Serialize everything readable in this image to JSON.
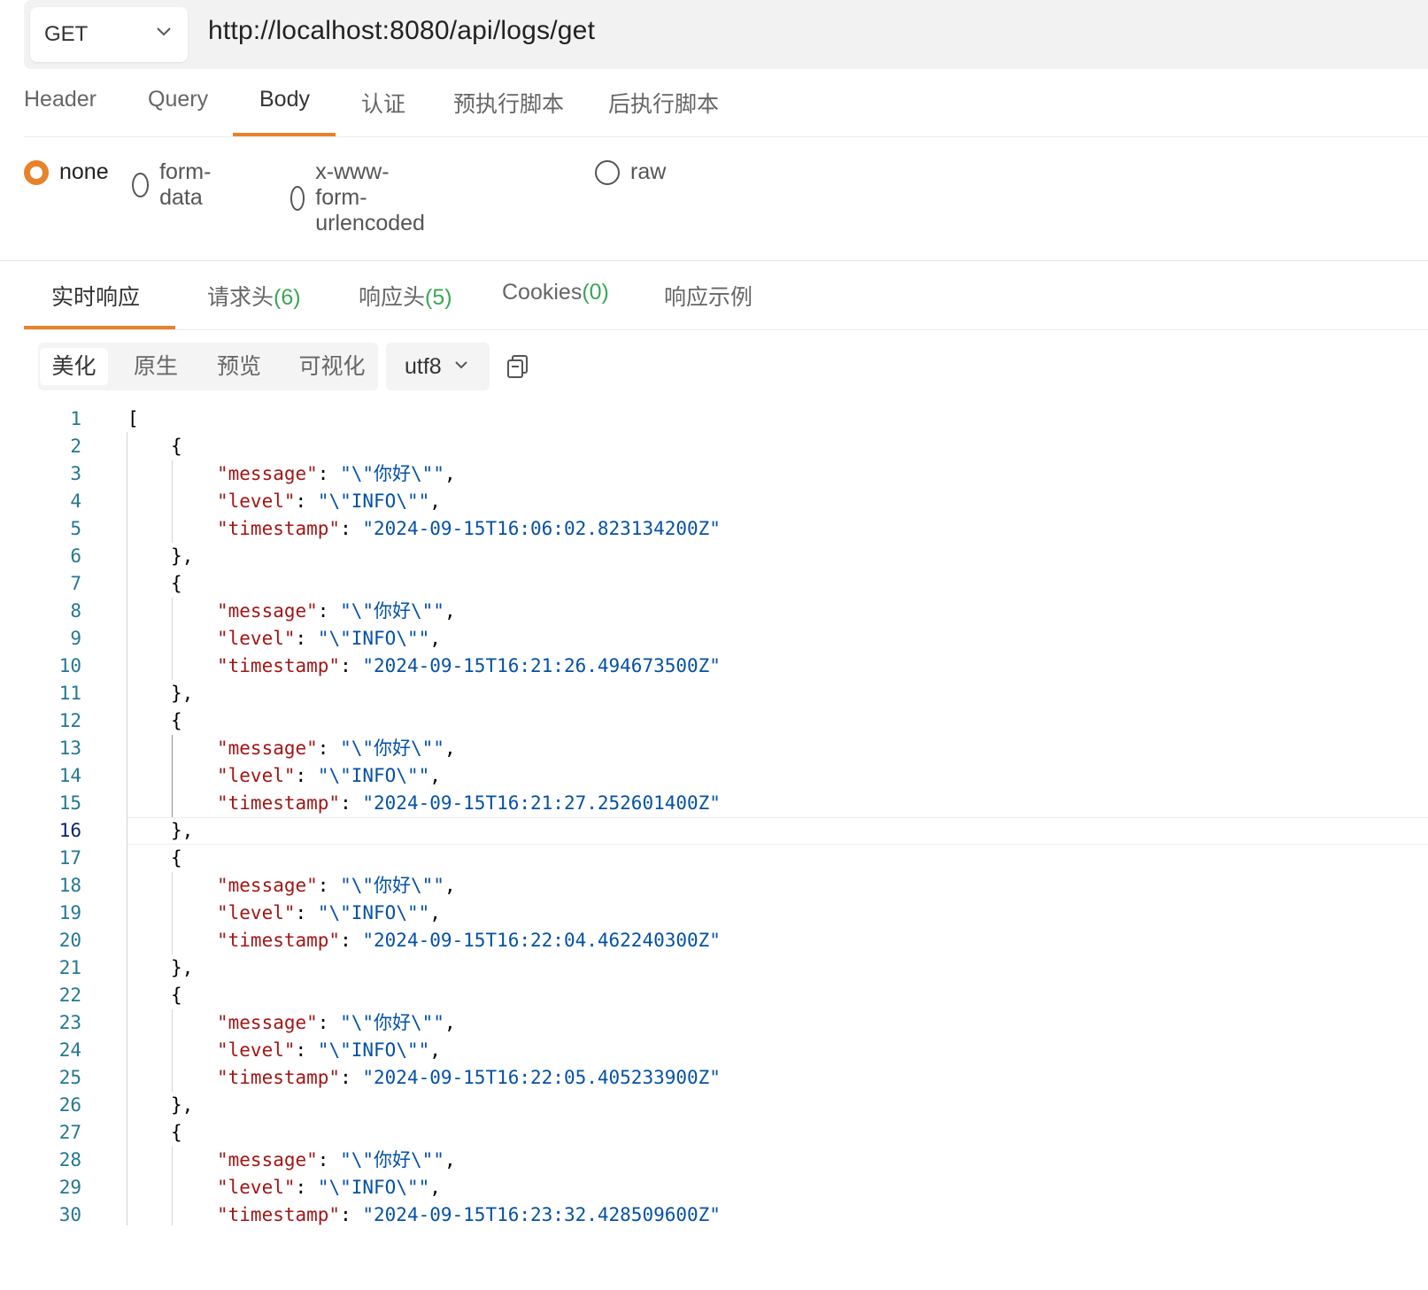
{
  "request": {
    "method": "GET",
    "url": "http://localhost:8080/api/logs/get"
  },
  "request_tabs": [
    {
      "label": "Header"
    },
    {
      "label": "Query"
    },
    {
      "label": "Body"
    },
    {
      "label": "认证"
    },
    {
      "label": "预执行脚本"
    },
    {
      "label": "后执行脚本"
    }
  ],
  "active_request_tab": "Body",
  "body_types": [
    {
      "label": "none"
    },
    {
      "label": "form-data"
    },
    {
      "label": "x-www-form-urlencoded"
    },
    {
      "label": "raw"
    }
  ],
  "selected_body_type": "none",
  "response_tabs": [
    {
      "label": "实时响应",
      "count": ""
    },
    {
      "label": "请求头",
      "count": "(6)"
    },
    {
      "label": "响应头",
      "count": "(5)"
    },
    {
      "label": "Cookies",
      "count": "(0)"
    },
    {
      "label": "响应示例",
      "count": ""
    }
  ],
  "view_modes": [
    {
      "label": "美化"
    },
    {
      "label": "原生"
    },
    {
      "label": "预览"
    },
    {
      "label": "可视化"
    }
  ],
  "active_view_mode": "美化",
  "encoding": "utf8",
  "current_line": 16,
  "colors": {
    "accent": "#e8822a",
    "count_green": "#3aa657",
    "json_key": "#a31515",
    "json_string": "#0451a5",
    "line_number": "#237893"
  },
  "icons": {
    "method_dropdown": "chevron-down-icon",
    "encoding_dropdown": "chevron-down-icon",
    "copy": "copy-icon"
  },
  "code_lines": [
    {
      "n": "1",
      "indent": 0,
      "parts": [
        {
          "t": "p",
          "v": "["
        }
      ]
    },
    {
      "n": "2",
      "indent": 1,
      "parts": [
        {
          "t": "p",
          "v": "{"
        }
      ]
    },
    {
      "n": "3",
      "indent": 2,
      "parts": [
        {
          "t": "k",
          "v": "\"message\""
        },
        {
          "t": "p",
          "v": ": "
        },
        {
          "t": "s",
          "v": "\"\\\"你好\\\"\""
        },
        {
          "t": "p",
          "v": ","
        }
      ]
    },
    {
      "n": "4",
      "indent": 2,
      "parts": [
        {
          "t": "k",
          "v": "\"level\""
        },
        {
          "t": "p",
          "v": ": "
        },
        {
          "t": "s",
          "v": "\"\\\"INFO\\\"\""
        },
        {
          "t": "p",
          "v": ","
        }
      ]
    },
    {
      "n": "5",
      "indent": 2,
      "parts": [
        {
          "t": "k",
          "v": "\"timestamp\""
        },
        {
          "t": "p",
          "v": ": "
        },
        {
          "t": "s",
          "v": "\"2024-09-15T16:06:02.823134200Z\""
        }
      ]
    },
    {
      "n": "6",
      "indent": 1,
      "parts": [
        {
          "t": "p",
          "v": "},"
        }
      ]
    },
    {
      "n": "7",
      "indent": 1,
      "parts": [
        {
          "t": "p",
          "v": "{"
        }
      ]
    },
    {
      "n": "8",
      "indent": 2,
      "parts": [
        {
          "t": "k",
          "v": "\"message\""
        },
        {
          "t": "p",
          "v": ": "
        },
        {
          "t": "s",
          "v": "\"\\\"你好\\\"\""
        },
        {
          "t": "p",
          "v": ","
        }
      ]
    },
    {
      "n": "9",
      "indent": 2,
      "parts": [
        {
          "t": "k",
          "v": "\"level\""
        },
        {
          "t": "p",
          "v": ": "
        },
        {
          "t": "s",
          "v": "\"\\\"INFO\\\"\""
        },
        {
          "t": "p",
          "v": ","
        }
      ]
    },
    {
      "n": "10",
      "indent": 2,
      "parts": [
        {
          "t": "k",
          "v": "\"timestamp\""
        },
        {
          "t": "p",
          "v": ": "
        },
        {
          "t": "s",
          "v": "\"2024-09-15T16:21:26.494673500Z\""
        }
      ]
    },
    {
      "n": "11",
      "indent": 1,
      "parts": [
        {
          "t": "p",
          "v": "},"
        }
      ]
    },
    {
      "n": "12",
      "indent": 1,
      "parts": [
        {
          "t": "p",
          "v": "{"
        }
      ]
    },
    {
      "n": "13",
      "indent": 2,
      "parts": [
        {
          "t": "k",
          "v": "\"message\""
        },
        {
          "t": "p",
          "v": ": "
        },
        {
          "t": "s",
          "v": "\"\\\"你好\\\"\""
        },
        {
          "t": "p",
          "v": ","
        }
      ]
    },
    {
      "n": "14",
      "indent": 2,
      "parts": [
        {
          "t": "k",
          "v": "\"level\""
        },
        {
          "t": "p",
          "v": ": "
        },
        {
          "t": "s",
          "v": "\"\\\"INFO\\\"\""
        },
        {
          "t": "p",
          "v": ","
        }
      ]
    },
    {
      "n": "15",
      "indent": 2,
      "parts": [
        {
          "t": "k",
          "v": "\"timestamp\""
        },
        {
          "t": "p",
          "v": ": "
        },
        {
          "t": "s",
          "v": "\"2024-09-15T16:21:27.252601400Z\""
        }
      ]
    },
    {
      "n": "16",
      "indent": 1,
      "parts": [
        {
          "t": "p",
          "v": "},"
        }
      ]
    },
    {
      "n": "17",
      "indent": 1,
      "parts": [
        {
          "t": "p",
          "v": "{"
        }
      ]
    },
    {
      "n": "18",
      "indent": 2,
      "parts": [
        {
          "t": "k",
          "v": "\"message\""
        },
        {
          "t": "p",
          "v": ": "
        },
        {
          "t": "s",
          "v": "\"\\\"你好\\\"\""
        },
        {
          "t": "p",
          "v": ","
        }
      ]
    },
    {
      "n": "19",
      "indent": 2,
      "parts": [
        {
          "t": "k",
          "v": "\"level\""
        },
        {
          "t": "p",
          "v": ": "
        },
        {
          "t": "s",
          "v": "\"\\\"INFO\\\"\""
        },
        {
          "t": "p",
          "v": ","
        }
      ]
    },
    {
      "n": "20",
      "indent": 2,
      "parts": [
        {
          "t": "k",
          "v": "\"timestamp\""
        },
        {
          "t": "p",
          "v": ": "
        },
        {
          "t": "s",
          "v": "\"2024-09-15T16:22:04.462240300Z\""
        }
      ]
    },
    {
      "n": "21",
      "indent": 1,
      "parts": [
        {
          "t": "p",
          "v": "},"
        }
      ]
    },
    {
      "n": "22",
      "indent": 1,
      "parts": [
        {
          "t": "p",
          "v": "{"
        }
      ]
    },
    {
      "n": "23",
      "indent": 2,
      "parts": [
        {
          "t": "k",
          "v": "\"message\""
        },
        {
          "t": "p",
          "v": ": "
        },
        {
          "t": "s",
          "v": "\"\\\"你好\\\"\""
        },
        {
          "t": "p",
          "v": ","
        }
      ]
    },
    {
      "n": "24",
      "indent": 2,
      "parts": [
        {
          "t": "k",
          "v": "\"level\""
        },
        {
          "t": "p",
          "v": ": "
        },
        {
          "t": "s",
          "v": "\"\\\"INFO\\\"\""
        },
        {
          "t": "p",
          "v": ","
        }
      ]
    },
    {
      "n": "25",
      "indent": 2,
      "parts": [
        {
          "t": "k",
          "v": "\"timestamp\""
        },
        {
          "t": "p",
          "v": ": "
        },
        {
          "t": "s",
          "v": "\"2024-09-15T16:22:05.405233900Z\""
        }
      ]
    },
    {
      "n": "26",
      "indent": 1,
      "parts": [
        {
          "t": "p",
          "v": "},"
        }
      ]
    },
    {
      "n": "27",
      "indent": 1,
      "parts": [
        {
          "t": "p",
          "v": "{"
        }
      ]
    },
    {
      "n": "28",
      "indent": 2,
      "parts": [
        {
          "t": "k",
          "v": "\"message\""
        },
        {
          "t": "p",
          "v": ": "
        },
        {
          "t": "s",
          "v": "\"\\\"你好\\\"\""
        },
        {
          "t": "p",
          "v": ","
        }
      ]
    },
    {
      "n": "29",
      "indent": 2,
      "parts": [
        {
          "t": "k",
          "v": "\"level\""
        },
        {
          "t": "p",
          "v": ": "
        },
        {
          "t": "s",
          "v": "\"\\\"INFO\\\"\""
        },
        {
          "t": "p",
          "v": ","
        }
      ]
    },
    {
      "n": "30",
      "indent": 2,
      "parts": [
        {
          "t": "k",
          "v": "\"timestamp\""
        },
        {
          "t": "p",
          "v": ": "
        },
        {
          "t": "s",
          "v": "\"2024-09-15T16:23:32.428509600Z\""
        }
      ]
    }
  ]
}
